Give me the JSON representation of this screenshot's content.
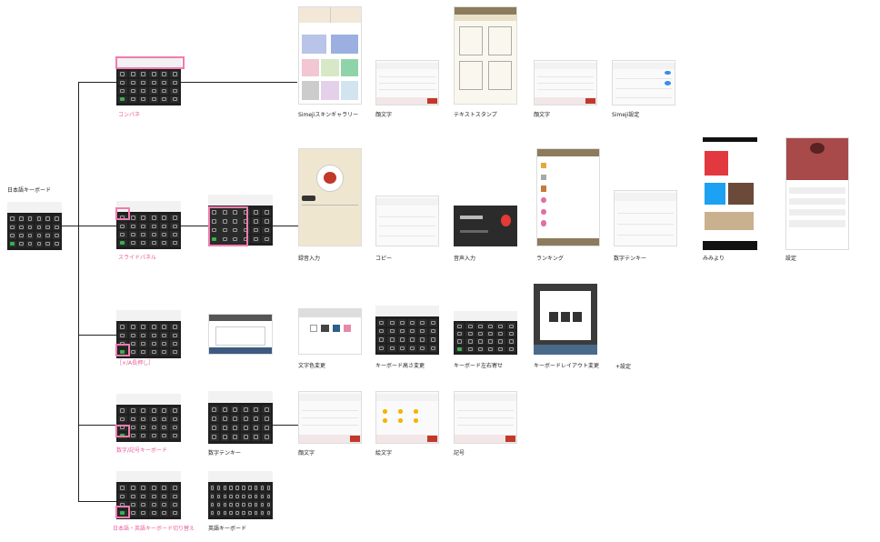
{
  "root": {
    "label": "日本語キーボード"
  },
  "branches": [
    {
      "label": "コンパネ"
    },
    {
      "label": "スライドパネル"
    },
    {
      "label": "［×/A長押し］"
    },
    {
      "label": "数字/記号キーボード"
    },
    {
      "label": "日本語・英語キーボード切り替え"
    }
  ],
  "row1": [
    "Simejiスキンギャラリー",
    "顔文字",
    "テキストスタンプ",
    "顔文字",
    "Simeji設定"
  ],
  "row2": [
    "録音入力",
    "コピー",
    "音声入力",
    "ランキング",
    "数字テンキー",
    "みみより",
    "設定"
  ],
  "row3": [
    "文字色変更",
    "キーボード高さ変更",
    "キーボード左右寄せ",
    "キーボードレイアウト変更",
    "+設定"
  ],
  "row4": [
    "数字テンキー",
    "顔文字",
    "絵文字",
    "記号"
  ],
  "row5": [
    "英語キーボード"
  ],
  "colors": {
    "highlight": "#f07cb0",
    "label_pink": "#e85b9a",
    "line": "#222222",
    "keyboard_dark": "#1f1f1f"
  }
}
